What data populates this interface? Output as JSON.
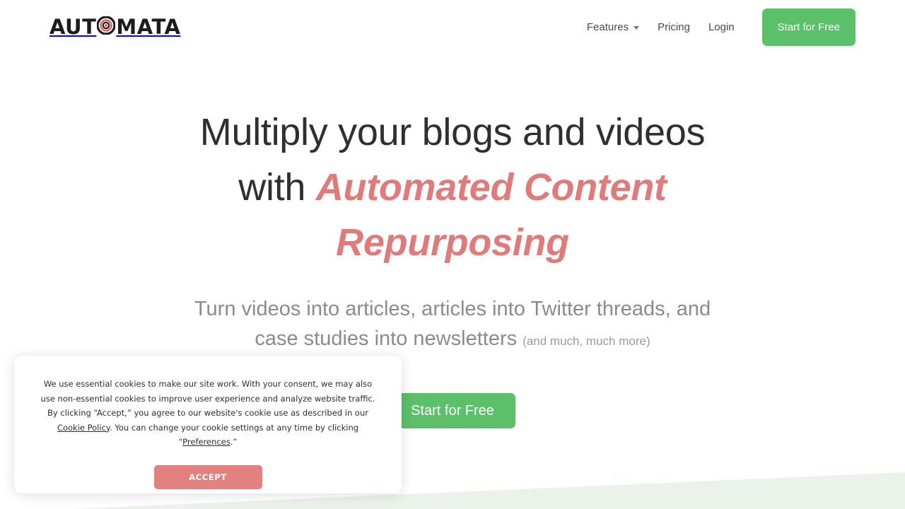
{
  "brand": {
    "name_part1": "AUT",
    "name_part2": "MATA",
    "logo_icon": "bullseye-target-icon",
    "accent_color": "#e07b7b",
    "green_color": "#5cbf6a"
  },
  "nav": {
    "items": [
      {
        "label": "Features",
        "has_dropdown": true,
        "icon": "chevron-down-icon"
      },
      {
        "label": "Pricing",
        "has_dropdown": false
      },
      {
        "label": "Login",
        "has_dropdown": false
      }
    ],
    "cta_label": "Start for Free"
  },
  "hero": {
    "title_line1": "Multiply your blogs and videos",
    "title_with": "with ",
    "title_accent": "Automated Content Repurposing",
    "subtitle_main": "Turn videos into articles, articles into Twitter threads, and case studies into newsletters",
    "subtitle_note": "(and much, much more)",
    "cta_label": "Start for Free"
  },
  "cookie_banner": {
    "text_part1": "We use essential cookies to make our site work. With your consent, we may also use non-essential cookies to improve user experience and analyze website traffic. By clicking “Accept,” you agree to our website's cookie use as described in our ",
    "link_policy": "Cookie Policy",
    "text_part2": ". You can change your cookie settings at any time by clicking “",
    "link_preferences": "Preferences",
    "text_part3": ".”",
    "accept_label": "ACCEPT"
  },
  "decoration": {
    "wedge_color": "#eaf2ea"
  }
}
